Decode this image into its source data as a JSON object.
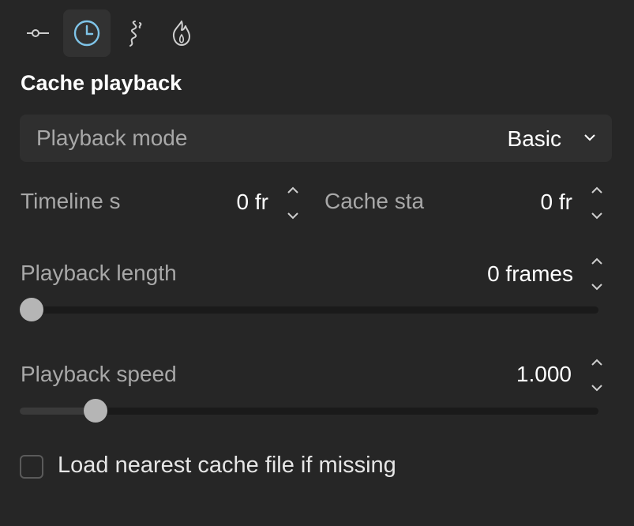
{
  "tabs": [
    {
      "icon": "connector-icon",
      "active": false
    },
    {
      "icon": "clock-icon",
      "active": true
    },
    {
      "icon": "smoke-icon",
      "active": false
    },
    {
      "icon": "flame-icon",
      "active": false
    }
  ],
  "section": {
    "title": "Cache playback"
  },
  "playback_mode": {
    "label": "Playback mode",
    "value": "Basic",
    "icon": "chevron-down-icon"
  },
  "timeline_start": {
    "label": "Timeline s",
    "value": "0 fr"
  },
  "cache_start": {
    "label": "Cache sta",
    "value": "0 fr"
  },
  "playback_length": {
    "label": "Playback length",
    "value": "0 frames",
    "slider_fraction": 0.0
  },
  "playback_speed": {
    "label": "Playback speed",
    "value": "1.000",
    "slider_fraction": 0.115
  },
  "load_nearest": {
    "label": "Load nearest cache file if missing",
    "checked": false
  },
  "colors": {
    "accent": "#7fc4e8",
    "background": "#262626",
    "text": "#ffffff"
  }
}
